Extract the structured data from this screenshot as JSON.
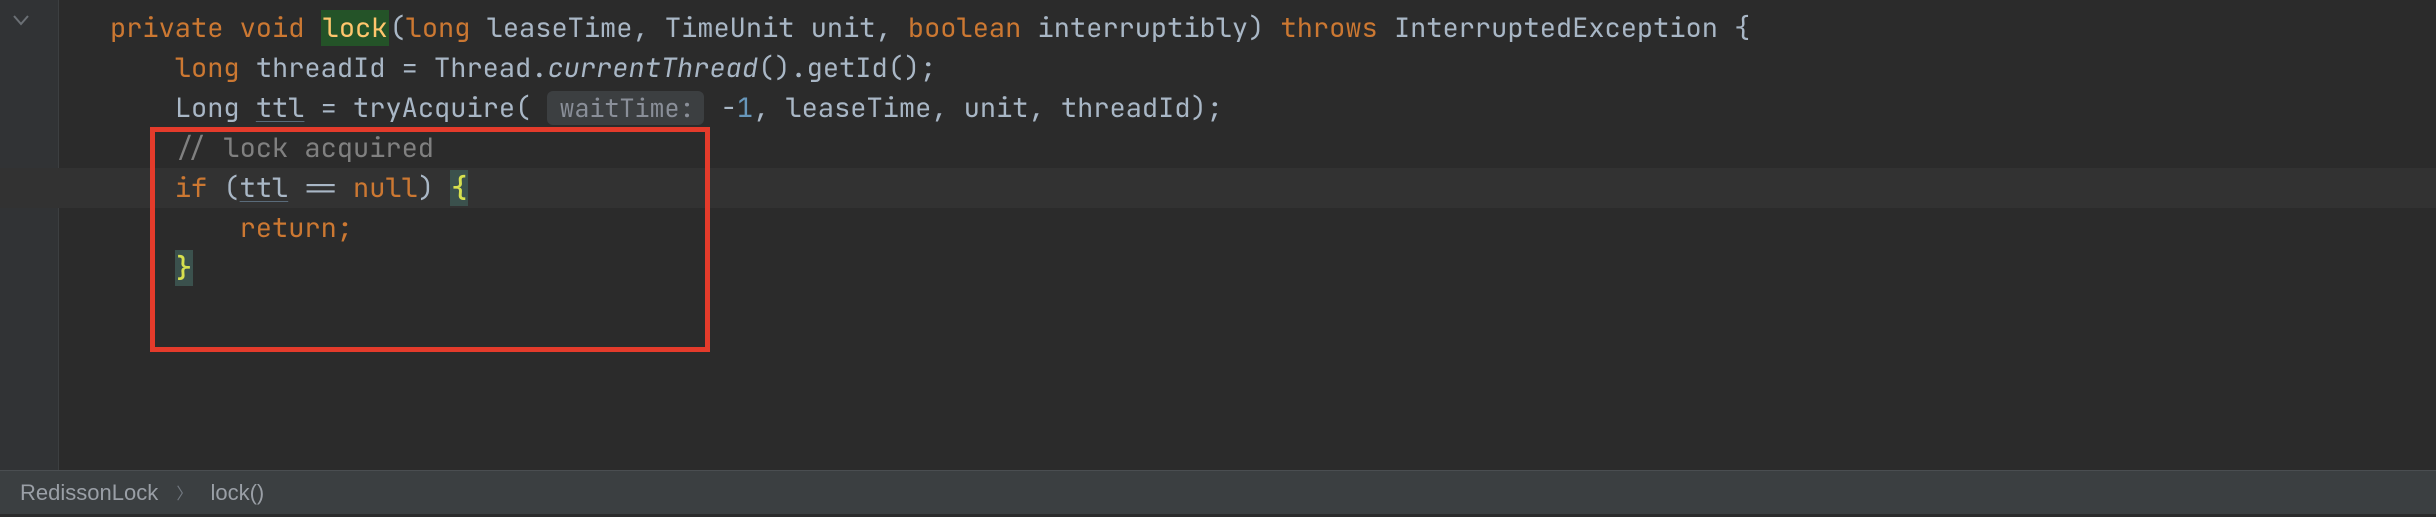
{
  "code": {
    "line1": {
      "kw_private": "private",
      "kw_void": "void",
      "fn_name": "lock",
      "p_long1": "long",
      "p_leaseTime": "leaseTime",
      "p_TimeUnit": "TimeUnit",
      "p_unit": "unit",
      "p_boolean": "boolean",
      "p_interruptibly": "interruptibly",
      "kw_throws": "throws",
      "ex": "InterruptedException"
    },
    "line2": {
      "kw_long": "long",
      "var": "threadId",
      "eq": "=",
      "thread": "Thread",
      "currentThread": "currentThread",
      "getId": "getId"
    },
    "line3": {
      "type_Long": "Long",
      "var": "ttl",
      "eq": "=",
      "tryAcquire": "tryAcquire",
      "hint": "waitTime:",
      "neg1": "-1",
      "leaseTime": "leaseTime",
      "unit": "unit",
      "threadId": "threadId"
    },
    "line4": {
      "comment": "// lock acquired"
    },
    "line5": {
      "kw_if": "if",
      "var": "ttl",
      "eqeq": "==",
      "kw_null": "null"
    },
    "line6": {
      "kw_return": "return"
    }
  },
  "breadcrumb": {
    "item1": "RedissonLock",
    "item2": "lock()"
  }
}
